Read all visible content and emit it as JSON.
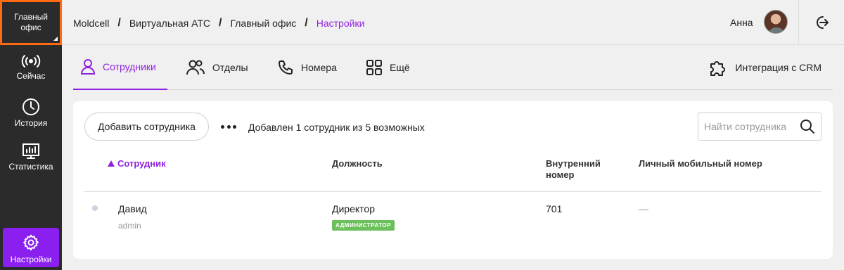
{
  "sidebar": {
    "office": {
      "line1": "Главный",
      "line2": "офис"
    },
    "items": [
      {
        "label": "Сейчас",
        "icon": "broadcast-icon"
      },
      {
        "label": "История",
        "icon": "clock-icon"
      },
      {
        "label": "Статистика",
        "icon": "chart-icon"
      }
    ],
    "settings": {
      "label": "Настройки",
      "icon": "gear-icon"
    }
  },
  "header": {
    "breadcrumbs": [
      "Moldcell",
      "Виртуальная АТС",
      "Главный офис",
      "Настройки"
    ],
    "user_name": "Анна"
  },
  "tabs": [
    {
      "label": "Сотрудники",
      "icon": "person-icon",
      "active": true
    },
    {
      "label": "Отделы",
      "icon": "people-icon"
    },
    {
      "label": "Номера",
      "icon": "phone-icon"
    },
    {
      "label": "Ещё",
      "icon": "grid-icon"
    }
  ],
  "crm_tab": {
    "label": "Интеграция с CRM",
    "icon": "puzzle-icon"
  },
  "toolbar": {
    "add_label": "Добавить сотрудника",
    "added_text": "Добавлен 1 сотрудник из 5 возможных",
    "search_placeholder": "Найти сотрудника"
  },
  "table": {
    "headers": {
      "employee": "Сотрудник",
      "position": "Должность",
      "ext_line1": "Внутренний",
      "ext_line2": "номер",
      "mobile": "Личный мобильный номер"
    },
    "rows": [
      {
        "name": "Давид",
        "login": "admin",
        "position": "Директор",
        "badge": "АДМИНИСТРАТОР",
        "ext": "701",
        "mobile": "—"
      }
    ]
  },
  "colors": {
    "accent": "#9021e0",
    "office_border": "#ff6a13",
    "badge": "#6cc05b"
  }
}
